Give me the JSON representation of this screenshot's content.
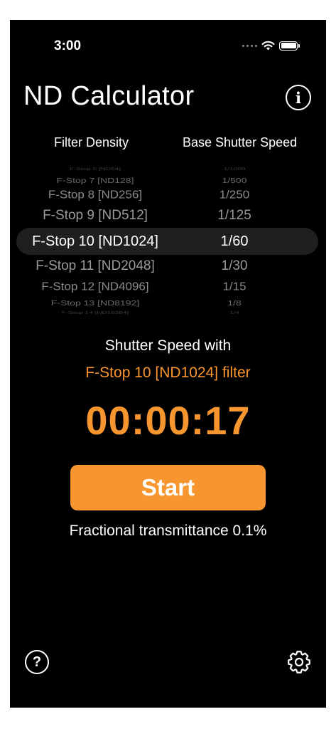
{
  "status_bar": {
    "time": "3:00"
  },
  "header": {
    "title": "ND Calculator",
    "info_icon": "info-circle-icon"
  },
  "columns": {
    "left": "Filter Density",
    "right": "Base Shutter Speed"
  },
  "picker": {
    "rows": [
      {
        "stop": "F-Stop 6 [ND64]",
        "speed": "1/1000"
      },
      {
        "stop": "F-Stop 7 [ND128]",
        "speed": "1/500"
      },
      {
        "stop": "F-Stop 8 [ND256]",
        "speed": "1/250"
      },
      {
        "stop": "F-Stop 9 [ND512]",
        "speed": "1/125"
      },
      {
        "stop": "F-Stop 10 [ND1024]",
        "speed": "1/60"
      },
      {
        "stop": "F-Stop 11 [ND2048]",
        "speed": "1/30"
      },
      {
        "stop": "F-Stop 12 [ND4096]",
        "speed": "1/15"
      },
      {
        "stop": "F-Stop 13 [ND8192]",
        "speed": "1/8"
      },
      {
        "stop": "F-Stop 14 [ND16384]",
        "speed": "1/4"
      }
    ]
  },
  "result": {
    "label": "Shutter Speed with",
    "filter": "F-Stop 10 [ND1024] filter",
    "timer": "00:00:17",
    "start_label": "Start",
    "transmittance": "Fractional transmittance 0.1%"
  },
  "footer": {
    "help_icon": "help-circle-icon",
    "help_label": "?",
    "settings_icon": "gear-icon"
  },
  "colors": {
    "accent": "#f7952f",
    "background": "#000000",
    "selection": "#1f1f21"
  }
}
